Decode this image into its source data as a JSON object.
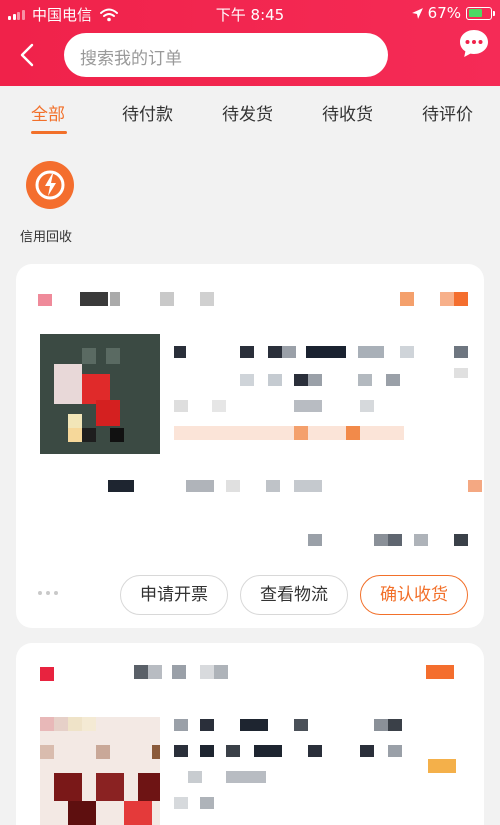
{
  "status_bar": {
    "carrier": "中国电信",
    "time": "下午 8:45",
    "battery": "67%",
    "battery_level": 0.67
  },
  "search": {
    "placeholder": "搜索我的订单"
  },
  "tabs": [
    {
      "label": "全部",
      "active": true
    },
    {
      "label": "待付款",
      "active": false
    },
    {
      "label": "待发货",
      "active": false
    },
    {
      "label": "待收货",
      "active": false
    },
    {
      "label": "待评价",
      "active": false
    }
  ],
  "shortcut": {
    "label": "信用回收"
  },
  "order1": {
    "actions": {
      "invoice": "申请开票",
      "logistics": "查看物流",
      "confirm": "确认收货"
    }
  },
  "colors": {
    "header": "#f0224a",
    "accent": "#f2702a"
  }
}
